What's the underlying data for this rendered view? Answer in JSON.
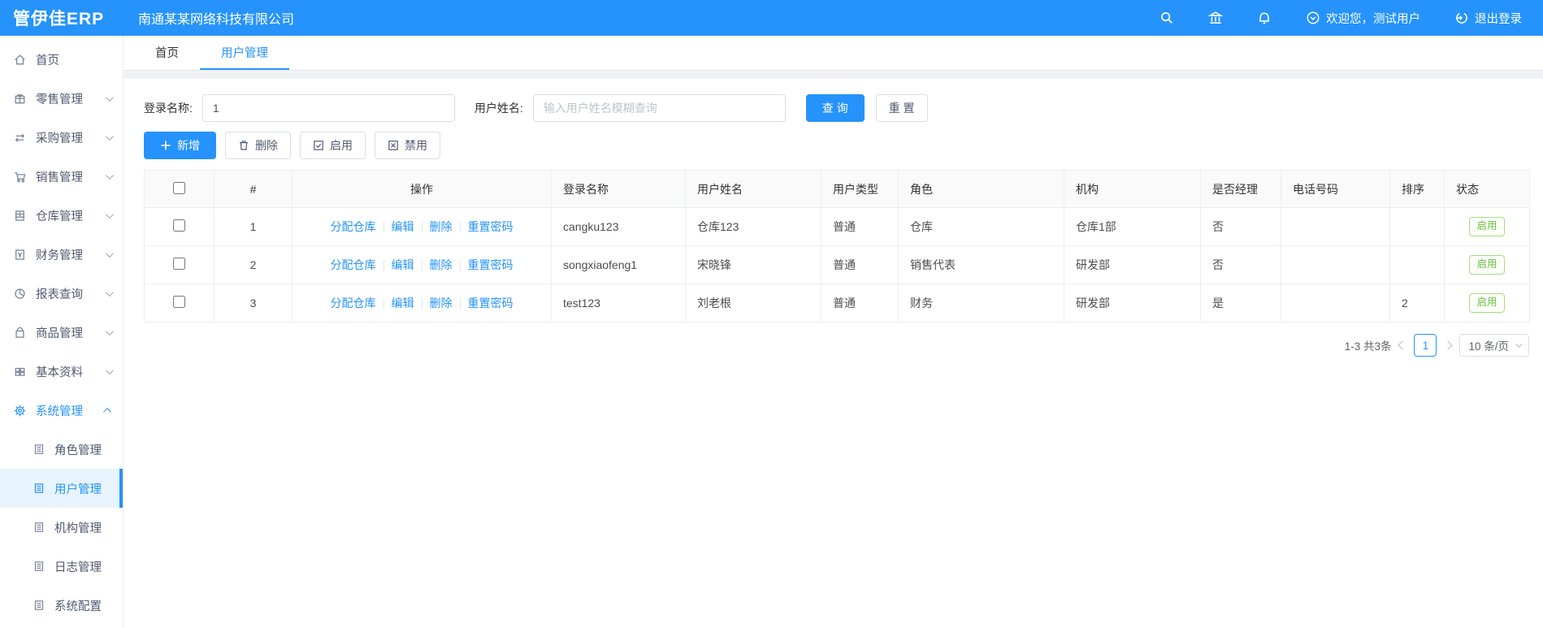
{
  "colors": {
    "primary_blue": "#2593fb",
    "active_item_bg": "#e7f4fe",
    "status_green_text": "#6dbe44",
    "status_green_border": "#a9dd80",
    "table_header_bg": "#fafafa"
  },
  "icons": {
    "header": [
      "search-icon",
      "bank-icon",
      "bell-icon",
      "circle-chevron-icon",
      "power-icon"
    ],
    "sidebar": [
      "home-icon",
      "gift-icon",
      "sync-icon",
      "cart-icon",
      "cabinet-icon",
      "finance-doc-icon",
      "pie-chart-icon",
      "bag-icon",
      "grid-icon",
      "gear-icon",
      "document-icon"
    ],
    "toolbar": [
      "plus-icon",
      "trash-icon",
      "checkbox-check-icon",
      "checkbox-x-icon"
    ]
  },
  "header": {
    "logo": "管伊佳ERP",
    "company": "南通某某网络科技有限公司",
    "welcome": "欢迎您，测试用户",
    "logout": "退出登录"
  },
  "sidebar": {
    "items": [
      {
        "label": "首页"
      },
      {
        "label": "零售管理"
      },
      {
        "label": "采购管理"
      },
      {
        "label": "销售管理"
      },
      {
        "label": "仓库管理"
      },
      {
        "label": "财务管理"
      },
      {
        "label": "报表查询"
      },
      {
        "label": "商品管理"
      },
      {
        "label": "基本资料"
      },
      {
        "label": "系统管理"
      }
    ],
    "subitems": [
      "角色管理",
      "用户管理",
      "机构管理",
      "日志管理",
      "系统配置"
    ],
    "active_item": "系统管理",
    "active_subitem": "用户管理"
  },
  "tabs": [
    {
      "label": "首页"
    },
    {
      "label": "用户管理"
    }
  ],
  "filter": {
    "login_label": "登录名称:",
    "login_value": "1",
    "name_label": "用户姓名:",
    "name_placeholder": "输入用户姓名模糊查询",
    "search_label": "查 询",
    "reset_label": "重 置"
  },
  "toolbar": {
    "add_label": "新增",
    "delete_label": "删除",
    "enable_label": "启用",
    "disable_label": "禁用"
  },
  "table": {
    "headers": [
      "#",
      "操作",
      "登录名称",
      "用户姓名",
      "用户类型",
      "角色",
      "机构",
      "是否经理",
      "电话号码",
      "排序",
      "状态"
    ],
    "ops": [
      "分配仓库",
      "编辑",
      "删除",
      "重置密码"
    ],
    "rows": [
      {
        "index": "1",
        "login": "cangku123",
        "name": "仓库123",
        "type": "普通",
        "role": "仓库",
        "org": "仓库1部",
        "manager": "否",
        "phone": "",
        "sort": "",
        "status": "启用"
      },
      {
        "index": "2",
        "login": "songxiaofeng1",
        "name": "宋晓锋",
        "type": "普通",
        "role": "销售代表",
        "org": "研发部",
        "manager": "否",
        "phone": "",
        "sort": "",
        "status": "启用"
      },
      {
        "index": "3",
        "login": "test123",
        "name": "刘老根",
        "type": "普通",
        "role": "财务",
        "org": "研发部",
        "manager": "是",
        "phone": "",
        "sort": "2",
        "status": "启用"
      }
    ]
  },
  "pagination": {
    "total": "1-3 共3条",
    "page": "1",
    "page_size": "10 条/页"
  }
}
